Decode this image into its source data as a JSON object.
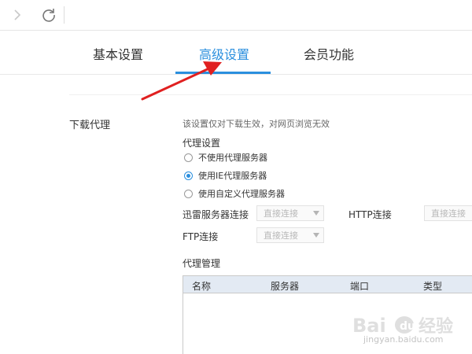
{
  "tabs": {
    "basic": "基本设置",
    "advanced": "高级设置",
    "vip": "会员功能"
  },
  "section": {
    "label": "下载代理",
    "hint": "该设置仅对下载生效，对网页浏览无效",
    "proxy_settings_title": "代理设置"
  },
  "radios": {
    "none": "不使用代理服务器",
    "ie": "使用IE代理服务器",
    "custom": "使用自定义代理服务器",
    "selected": "使用IE代理服务器"
  },
  "fields": {
    "xunlei_label": "迅雷服务器连接",
    "xunlei_value": "直接连接",
    "http_label": "HTTP连接",
    "http_value": "直接连接",
    "ftp_label": "FTP连接",
    "ftp_value": "直接连接"
  },
  "management": {
    "title": "代理管理",
    "columns": [
      "名称",
      "服务器",
      "端口",
      "类型"
    ],
    "rows": []
  },
  "watermark": {
    "text": "Bai du 经验",
    "url": "jingyan.baidu.com"
  },
  "colors": {
    "accent": "#2b8fde",
    "arrow": "#e02020",
    "table_header": "#e3eaf3"
  },
  "icons": [
    "forward-arrow-icon",
    "refresh-icon",
    "radio-icon",
    "dropdown-caret-icon"
  ]
}
